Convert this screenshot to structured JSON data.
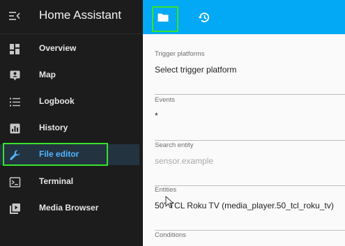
{
  "app": {
    "title": "Home Assistant"
  },
  "sidebar": {
    "items": [
      {
        "label": "Overview",
        "icon": "overview-icon"
      },
      {
        "label": "Map",
        "icon": "map-icon"
      },
      {
        "label": "Logbook",
        "icon": "logbook-icon"
      },
      {
        "label": "History",
        "icon": "history-chart-icon"
      },
      {
        "label": "File editor",
        "icon": "wrench-icon",
        "active": true
      },
      {
        "label": "Terminal",
        "icon": "terminal-icon"
      },
      {
        "label": "Media Browser",
        "icon": "media-browser-icon"
      }
    ]
  },
  "toolbar": {
    "buttons": [
      {
        "icon": "folder-icon"
      },
      {
        "icon": "history-icon"
      }
    ],
    "color": "#03a9f4"
  },
  "form": {
    "trigger_platforms": {
      "label": "Trigger platforms",
      "value": "Select trigger platform"
    },
    "events": {
      "label": "Events",
      "value": "*"
    },
    "search_entity": {
      "label": "Search entity",
      "placeholder": "sensor.example"
    },
    "entities": {
      "label": "Entities",
      "value": "50\" TCL Roku TV (media_player.50_tcl_roku_tv)"
    },
    "conditions": {
      "label": "Conditions"
    }
  },
  "colors": {
    "sidebar_bg": "#1c1c1c",
    "accent": "#03a9f4",
    "active_text": "#51b6ff",
    "highlight": "#39e22d"
  }
}
